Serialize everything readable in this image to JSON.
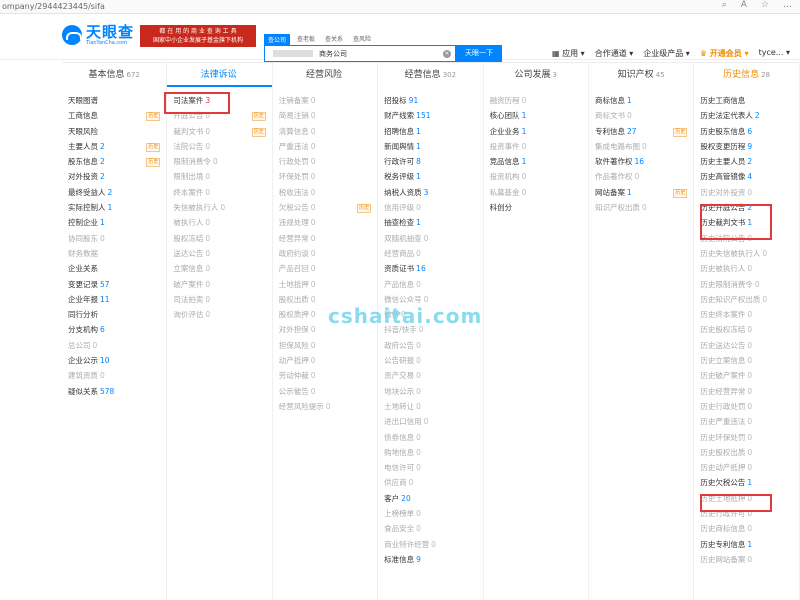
{
  "address_bar": {
    "url": "ompany/2944423445/sifa",
    "zoom_icon": "A",
    "fav_icon": "☆",
    "menu_icon": "…"
  },
  "header": {
    "logo_title": "天眼查",
    "logo_sub": "TianYanCha.com",
    "promo_line1": "都 在 用 的 商 业 查 询 工 具",
    "promo_line2": "国家中小企业发展子基金旗下机构",
    "search_tabs": [
      "查公司",
      "查老板",
      "查关系",
      "查风险"
    ],
    "search_value": "商务公司",
    "search_button": "天眼一下",
    "nav": [
      "应用",
      "合作通道",
      "企业级产品",
      "开通会员",
      "tyce..."
    ]
  },
  "columns": [
    {
      "title": "基本信息",
      "count": "672",
      "items": [
        {
          "label": "天眼图谱",
          "n": "",
          "dim": false
        },
        {
          "label": "工商信息",
          "n": "",
          "dim": false,
          "tag": "历史"
        },
        {
          "label": "天眼风险",
          "n": "",
          "dim": false
        },
        {
          "label": "主要人员",
          "n": "2",
          "dim": false,
          "tag": "历史"
        },
        {
          "label": "股东信息",
          "n": "2",
          "dim": false,
          "tag": "历史"
        },
        {
          "label": "对外投资",
          "n": "2",
          "dim": false
        },
        {
          "label": "最终受益人",
          "n": "2",
          "dim": false
        },
        {
          "label": "实际控制人",
          "n": "1",
          "dim": false
        },
        {
          "label": "控制企业",
          "n": "1",
          "dim": false
        },
        {
          "label": "协同股东",
          "n": "0",
          "dim": true
        },
        {
          "label": "财务数据",
          "n": "",
          "dim": true
        },
        {
          "label": "企业关系",
          "n": "",
          "dim": false
        },
        {
          "label": "变更记录",
          "n": "57",
          "dim": false
        },
        {
          "label": "企业年报",
          "n": "11",
          "dim": false
        },
        {
          "label": "同行分析",
          "n": "",
          "dim": false
        },
        {
          "label": "分支机构",
          "n": "6",
          "dim": false
        },
        {
          "label": "总公司",
          "n": "0",
          "dim": true
        },
        {
          "label": "企业公示",
          "n": "10",
          "dim": false
        },
        {
          "label": "建筑资质",
          "n": "0",
          "dim": true
        },
        {
          "label": "疑似关系",
          "n": "578",
          "dim": false
        }
      ]
    },
    {
      "title": "法律诉讼",
      "count": "",
      "items": [
        {
          "label": "司法案件",
          "n": "3",
          "dim": false,
          "red": true
        },
        {
          "label": "开庭公告",
          "n": "0",
          "dim": true,
          "tag": "历史"
        },
        {
          "label": "裁判文书",
          "n": "0",
          "dim": true,
          "tag": "历史"
        },
        {
          "label": "法院公告",
          "n": "0",
          "dim": true
        },
        {
          "label": "限制消费令",
          "n": "0",
          "dim": true
        },
        {
          "label": "限制出境",
          "n": "0",
          "dim": true
        },
        {
          "label": "终本案件",
          "n": "0",
          "dim": true
        },
        {
          "label": "失信被执行人",
          "n": "0",
          "dim": true
        },
        {
          "label": "被执行人",
          "n": "0",
          "dim": true
        },
        {
          "label": "股权冻结",
          "n": "0",
          "dim": true
        },
        {
          "label": "送达公告",
          "n": "0",
          "dim": true
        },
        {
          "label": "立案信息",
          "n": "0",
          "dim": true
        },
        {
          "label": "破产案件",
          "n": "0",
          "dim": true
        },
        {
          "label": "司法拍卖",
          "n": "0",
          "dim": true
        },
        {
          "label": "询价评估",
          "n": "0",
          "dim": true
        }
      ]
    },
    {
      "title": "经营风险",
      "count": "",
      "items": [
        {
          "label": "注销备案",
          "n": "0",
          "dim": true
        },
        {
          "label": "简易注销",
          "n": "0",
          "dim": true
        },
        {
          "label": "清算信息",
          "n": "0",
          "dim": true
        },
        {
          "label": "严重违法",
          "n": "0",
          "dim": true
        },
        {
          "label": "行政处罚",
          "n": "0",
          "dim": true
        },
        {
          "label": "环保处罚",
          "n": "0",
          "dim": true
        },
        {
          "label": "税收违法",
          "n": "0",
          "dim": true
        },
        {
          "label": "欠税公告",
          "n": "0",
          "dim": true,
          "tag": "历史"
        },
        {
          "label": "违规处理",
          "n": "0",
          "dim": true
        },
        {
          "label": "经营异常",
          "n": "0",
          "dim": true
        },
        {
          "label": "政府约谈",
          "n": "0",
          "dim": true
        },
        {
          "label": "产品召回",
          "n": "0",
          "dim": true
        },
        {
          "label": "土地抵押",
          "n": "0",
          "dim": true
        },
        {
          "label": "股权出质",
          "n": "0",
          "dim": true
        },
        {
          "label": "股权质押",
          "n": "0",
          "dim": true
        },
        {
          "label": "对外担保",
          "n": "0",
          "dim": true
        },
        {
          "label": "担保风险",
          "n": "0",
          "dim": true
        },
        {
          "label": "动产抵押",
          "n": "0",
          "dim": true
        },
        {
          "label": "劳动仲裁",
          "n": "0",
          "dim": true
        },
        {
          "label": "公示催告",
          "n": "0",
          "dim": true
        },
        {
          "label": "经营风险提示",
          "n": "0",
          "dim": true
        }
      ]
    },
    {
      "title": "经营信息",
      "count": "302",
      "items": [
        {
          "label": "招投标",
          "n": "91",
          "dim": false
        },
        {
          "label": "财产线索",
          "n": "151",
          "dim": false
        },
        {
          "label": "招聘信息",
          "n": "1",
          "dim": false
        },
        {
          "label": "新闻舆情",
          "n": "1",
          "dim": false
        },
        {
          "label": "行政许可",
          "n": "8",
          "dim": false
        },
        {
          "label": "税务评级",
          "n": "1",
          "dim": false
        },
        {
          "label": "纳税人资质",
          "n": "3",
          "dim": false
        },
        {
          "label": "信用评级",
          "n": "0",
          "dim": true
        },
        {
          "label": "抽查检查",
          "n": "1",
          "dim": false
        },
        {
          "label": "双随机抽查",
          "n": "0",
          "dim": true
        },
        {
          "label": "经营商品",
          "n": "0",
          "dim": true
        },
        {
          "label": "资质证书",
          "n": "16",
          "dim": false
        },
        {
          "label": "产品信息",
          "n": "0",
          "dim": true
        },
        {
          "label": "微信公众号",
          "n": "0",
          "dim": true
        },
        {
          "label": "微博",
          "n": "0",
          "dim": true
        },
        {
          "label": "抖音/快手",
          "n": "0",
          "dim": true
        },
        {
          "label": "政府公告",
          "n": "0",
          "dim": true
        },
        {
          "label": "公告研报",
          "n": "0",
          "dim": true
        },
        {
          "label": "资产交易",
          "n": "0",
          "dim": true
        },
        {
          "label": "地块公示",
          "n": "0",
          "dim": true
        },
        {
          "label": "土地转让",
          "n": "0",
          "dim": true
        },
        {
          "label": "进出口信用",
          "n": "0",
          "dim": true
        },
        {
          "label": "债券信息",
          "n": "0",
          "dim": true
        },
        {
          "label": "购地信息",
          "n": "0",
          "dim": true
        },
        {
          "label": "电信许可",
          "n": "0",
          "dim": true
        },
        {
          "label": "供应商",
          "n": "0",
          "dim": true
        },
        {
          "label": "客户",
          "n": "20",
          "dim": false
        },
        {
          "label": "上榜榜单",
          "n": "0",
          "dim": true
        },
        {
          "label": "食品安全",
          "n": "0",
          "dim": true
        },
        {
          "label": "商业特许经营",
          "n": "0",
          "dim": true
        },
        {
          "label": "标准信息",
          "n": "9",
          "dim": false
        }
      ]
    },
    {
      "title": "公司发展",
      "count": "3",
      "items": [
        {
          "label": "融资历程",
          "n": "0",
          "dim": true
        },
        {
          "label": "核心团队",
          "n": "1",
          "dim": false
        },
        {
          "label": "企业业务",
          "n": "1",
          "dim": false
        },
        {
          "label": "投资事件",
          "n": "0",
          "dim": true
        },
        {
          "label": "竞品信息",
          "n": "1",
          "dim": false
        },
        {
          "label": "投资机构",
          "n": "0",
          "dim": true
        },
        {
          "label": "私募基金",
          "n": "0",
          "dim": true
        },
        {
          "label": "科创分",
          "n": "",
          "dim": false
        }
      ]
    },
    {
      "title": "知识产权",
      "count": "45",
      "items": [
        {
          "label": "商标信息",
          "n": "1",
          "dim": false
        },
        {
          "label": "商标文书",
          "n": "0",
          "dim": true
        },
        {
          "label": "专利信息",
          "n": "27",
          "dim": false,
          "tag": "历史"
        },
        {
          "label": "集成电路布图",
          "n": "0",
          "dim": true
        },
        {
          "label": "软件著作权",
          "n": "16",
          "dim": false
        },
        {
          "label": "作品著作权",
          "n": "0",
          "dim": true
        },
        {
          "label": "网站备案",
          "n": "1",
          "dim": false,
          "tag": "历史"
        },
        {
          "label": "知识产权出质",
          "n": "0",
          "dim": true
        }
      ]
    },
    {
      "title": "历史信息",
      "count": "28",
      "items": [
        {
          "label": "历史工商信息",
          "n": "",
          "dim": false
        },
        {
          "label": "历史法定代表人",
          "n": "2",
          "dim": false
        },
        {
          "label": "历史股东信息",
          "n": "6",
          "dim": false
        },
        {
          "label": "股权变更历程",
          "n": "9",
          "dim": false
        },
        {
          "label": "历史主要人员",
          "n": "2",
          "dim": false
        },
        {
          "label": "历史高管镜像",
          "n": "4",
          "dim": false
        },
        {
          "label": "历史对外投资",
          "n": "0",
          "dim": true
        },
        {
          "label": "历史开庭公告",
          "n": "2",
          "dim": false
        },
        {
          "label": "历史裁判文书",
          "n": "1",
          "dim": false
        },
        {
          "label": "历史法院公告",
          "n": "0",
          "dim": true
        },
        {
          "label": "历史失信被执行人",
          "n": "0",
          "dim": true
        },
        {
          "label": "历史被执行人",
          "n": "0",
          "dim": true
        },
        {
          "label": "历史限制消费令",
          "n": "0",
          "dim": true
        },
        {
          "label": "历史知识产权出质",
          "n": "0",
          "dim": true
        },
        {
          "label": "历史终本案件",
          "n": "0",
          "dim": true
        },
        {
          "label": "历史股权冻结",
          "n": "0",
          "dim": true
        },
        {
          "label": "历史送达公告",
          "n": "0",
          "dim": true
        },
        {
          "label": "历史立案信息",
          "n": "0",
          "dim": true
        },
        {
          "label": "历史破产案件",
          "n": "0",
          "dim": true
        },
        {
          "label": "历史经营异常",
          "n": "0",
          "dim": true
        },
        {
          "label": "历史行政处罚",
          "n": "0",
          "dim": true
        },
        {
          "label": "历史严重违法",
          "n": "0",
          "dim": true
        },
        {
          "label": "历史环保处罚",
          "n": "0",
          "dim": true
        },
        {
          "label": "历史股权出质",
          "n": "0",
          "dim": true
        },
        {
          "label": "历史动产抵押",
          "n": "0",
          "dim": true
        },
        {
          "label": "历史欠税公告",
          "n": "1",
          "dim": false
        },
        {
          "label": "历史土地抵押",
          "n": "0",
          "dim": true
        },
        {
          "label": "历史行政许可",
          "n": "0",
          "dim": true
        },
        {
          "label": "历史商标信息",
          "n": "0",
          "dim": true
        },
        {
          "label": "历史专利信息",
          "n": "1",
          "dim": false
        },
        {
          "label": "历史网站备案",
          "n": "0",
          "dim": true
        }
      ]
    }
  ],
  "watermark": "cshaitai.com",
  "colors": {
    "brand": "#0084ff",
    "highlight": "#e4393c",
    "history": "#f08c00"
  }
}
